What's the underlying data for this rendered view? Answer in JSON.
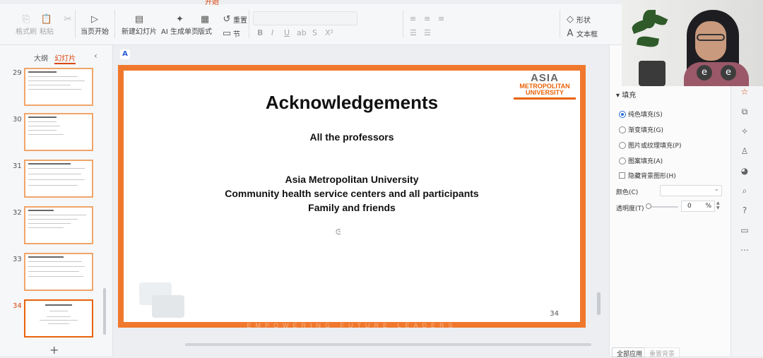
{
  "ribbon": {
    "tabs": [
      "开始"
    ],
    "groups": [
      {
        "label": "格式刷",
        "icon": "format-painter-icon",
        "enabled": false
      },
      {
        "label": "粘贴",
        "icon": "paste-icon",
        "enabled": false
      },
      {
        "label": "当页开始",
        "icon": "play-from-current-icon",
        "enabled": true
      },
      {
        "label": "新建幻灯片",
        "icon": "new-slide-icon",
        "enabled": true
      },
      {
        "label": "AI 生成单页",
        "icon": "ai-generate-icon",
        "enabled": true
      },
      {
        "label": "版式",
        "icon": "layout-icon",
        "enabled": true
      },
      {
        "label": "节",
        "icon": "section-icon",
        "enabled": true
      },
      {
        "label": "重置",
        "icon": "reset-icon",
        "enabled": true
      },
      {
        "label": "形状",
        "icon": "shape-icon",
        "enabled": true
      },
      {
        "label": "文本框",
        "icon": "textbox-icon",
        "enabled": true
      }
    ],
    "format_glyphs": [
      "B",
      "I",
      "U",
      "ab",
      "S",
      "X²"
    ]
  },
  "left_panel": {
    "tabs": [
      {
        "label": "大纲",
        "active": false
      },
      {
        "label": "幻灯片",
        "active": true
      }
    ],
    "slides": [
      {
        "number": "29",
        "active": false
      },
      {
        "number": "30",
        "active": false
      },
      {
        "number": "31",
        "active": false
      },
      {
        "number": "32",
        "active": false
      },
      {
        "number": "33",
        "active": false
      },
      {
        "number": "34",
        "active": true
      }
    ],
    "add_symbol": "+"
  },
  "slide": {
    "title": "Acknowledgements",
    "line1": "All the professors",
    "line2": "Asia Metropolitan University",
    "line3": "Community health service centers and all participants",
    "line4": "Family and friends",
    "page_number": "34",
    "slogan": "EMPOWERING FUTURE LEADERS",
    "logo": {
      "l1": "ASIA",
      "l2": "METROPOLITAN",
      "l3": "UNIVERSITY"
    }
  },
  "right_panel": {
    "section_title": "填充",
    "fill_options": [
      {
        "label": "纯色填充(S)",
        "selected": true
      },
      {
        "label": "渐变填充(G)",
        "selected": false
      },
      {
        "label": "图片或纹理填充(P)",
        "selected": false
      },
      {
        "label": "图案填充(A)",
        "selected": false
      }
    ],
    "hide_bg_label": "隐藏背景图形(H)",
    "color_label": "颜色(C)",
    "transparency_label": "透明度(T)",
    "transparency_value": "0",
    "transparency_unit": "%",
    "apply_all_label": "全部应用",
    "reset_bg_label": "重置背景"
  },
  "video": {
    "badge1": "e",
    "badge2": "e"
  },
  "colors": {
    "accent": "#e8630a",
    "slide_border": "#f0782d",
    "radio_selected": "#2a6fdb"
  }
}
